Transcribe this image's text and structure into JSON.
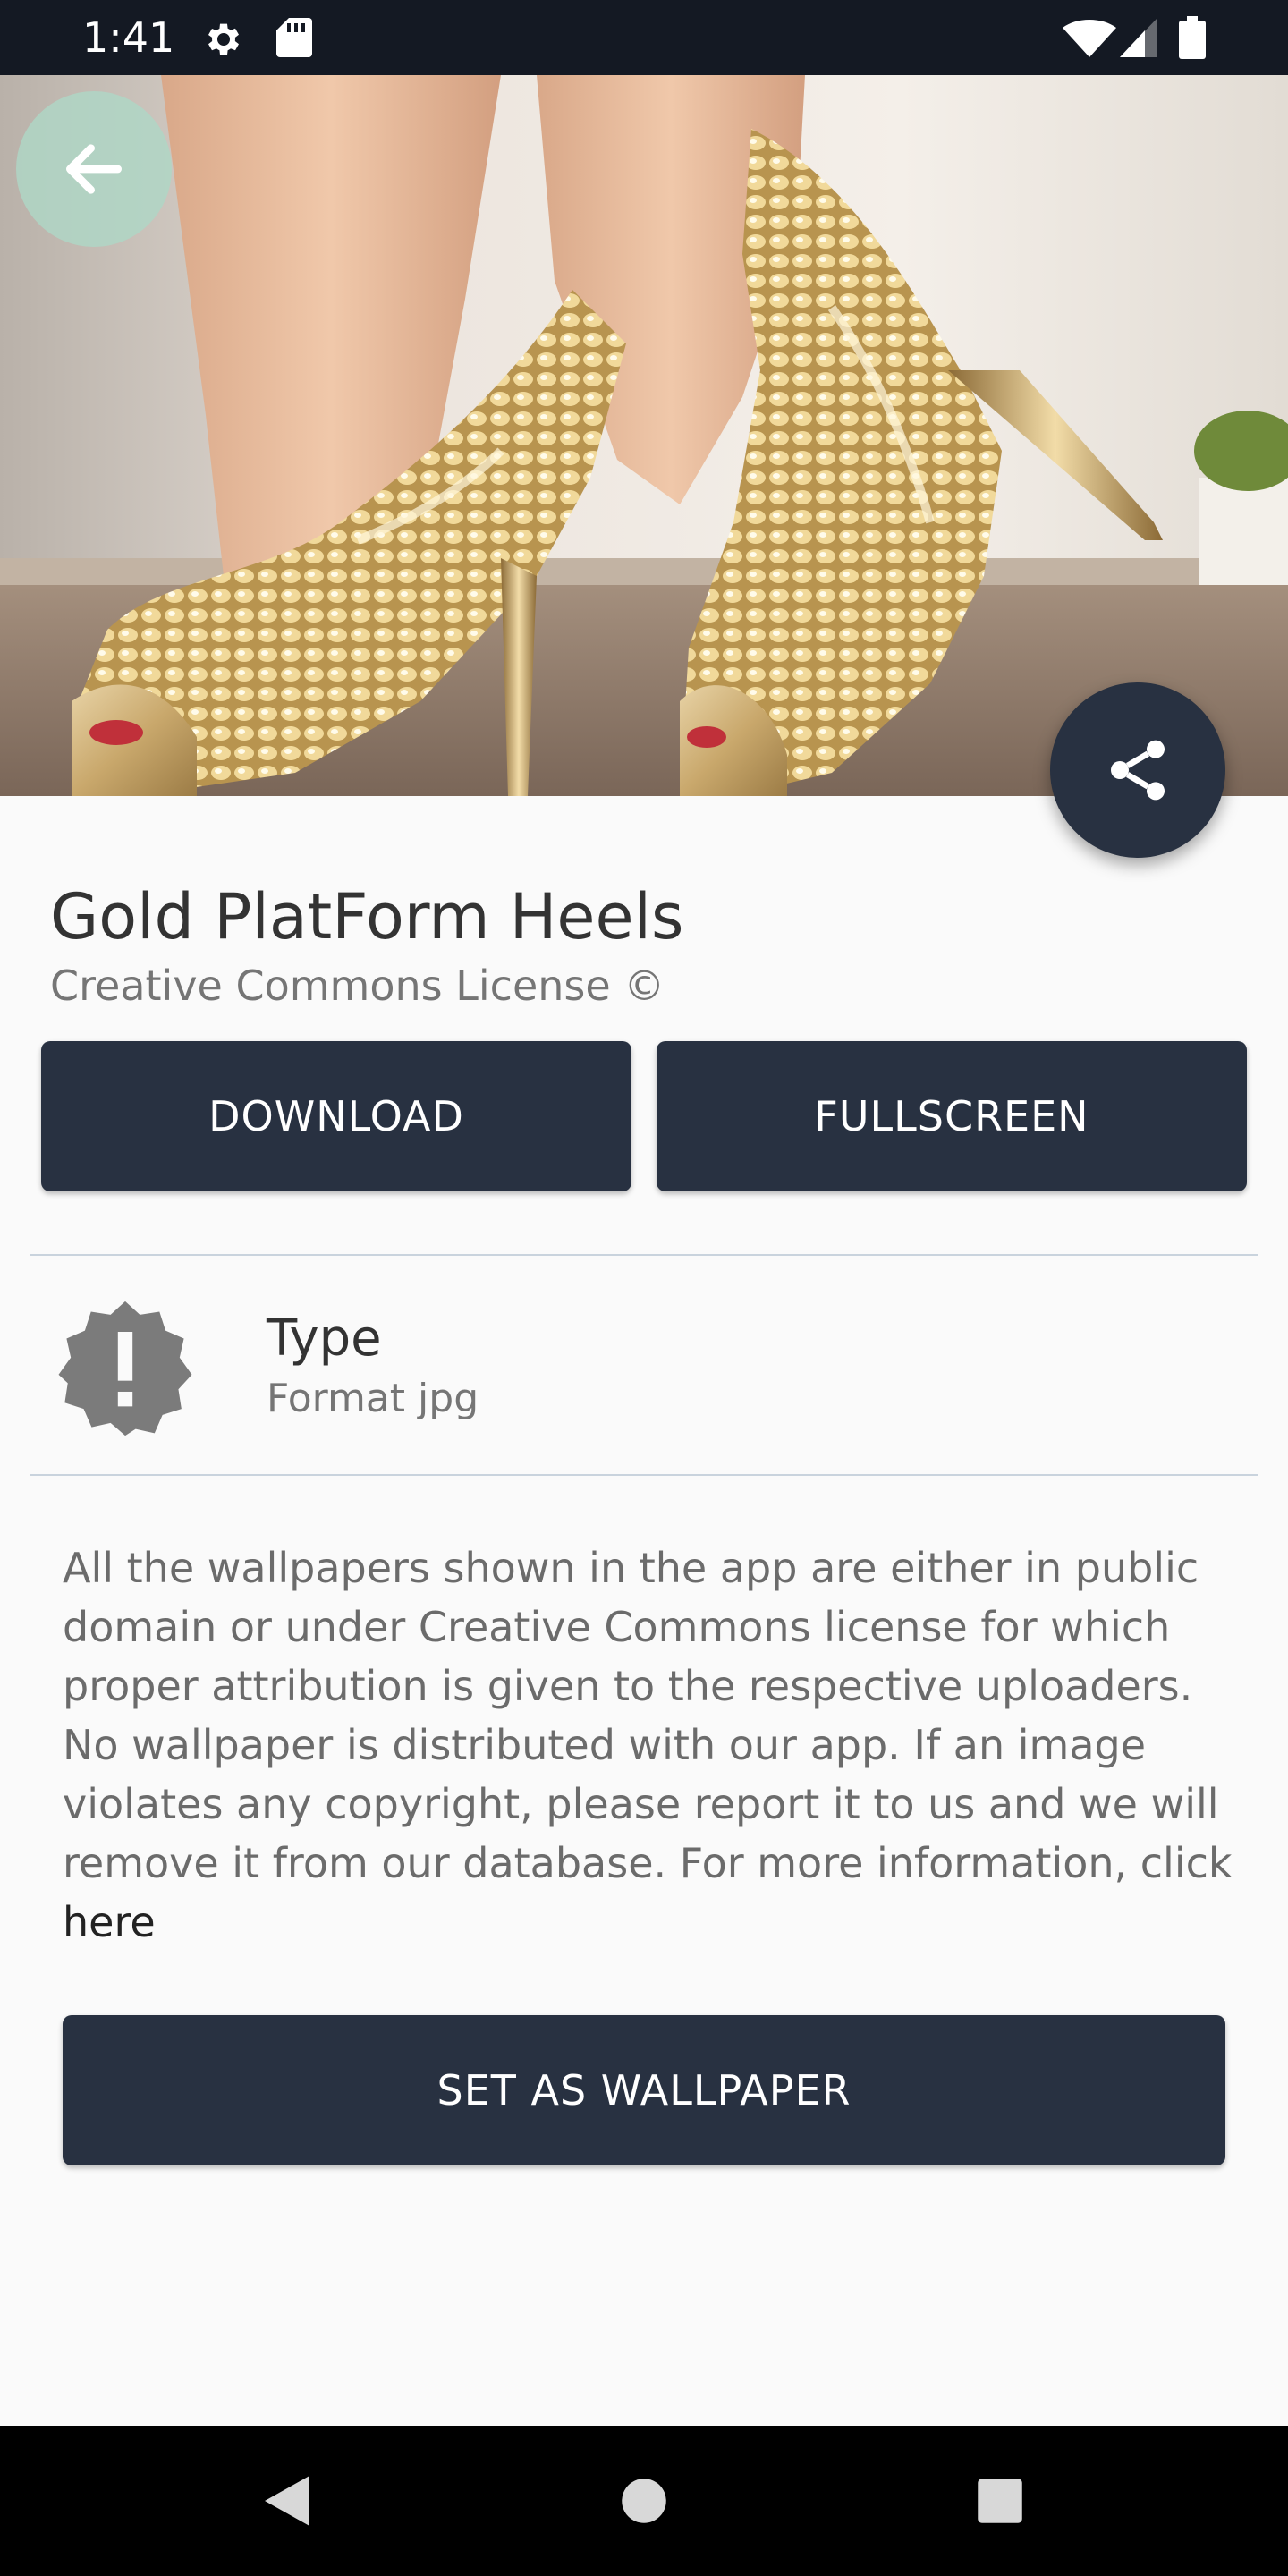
{
  "status_bar": {
    "time": "1:41",
    "icons": [
      "gear-icon",
      "sd-card-icon",
      "wifi-icon",
      "signal-icon",
      "battery-icon"
    ]
  },
  "hero": {
    "image": "gold-platform-heels-photo",
    "back_icon": "arrow-left-icon",
    "share_icon": "share-icon"
  },
  "wallpaper": {
    "title": "Gold PlatForm Heels",
    "license": "Creative Commons License ©"
  },
  "actions": {
    "download_label": "DOWNLOAD",
    "fullscreen_label": "FULLSCREEN",
    "set_wallpaper_label": "SET AS WALLPAPER"
  },
  "info": {
    "icon": "alert-badge-icon",
    "type_label": "Type",
    "type_value": "Format jpg"
  },
  "disclaimer": {
    "text": "All the wallpapers shown in the app are either in public domain or under Creative Commons license for which proper attribution is given to the respective uploaders. No wallpaper is distributed with our app. If an image violates any copyright, please report it to us and we will remove it from our database. For more information, click ",
    "link_text": "here"
  },
  "nav_bar": {
    "icons": [
      "nav-back-icon",
      "nav-home-icon",
      "nav-recents-icon"
    ]
  },
  "colors": {
    "primary_dark": "#283141",
    "status_bar": "#141923",
    "back_button": "#aed7c6",
    "background": "#fafafa"
  }
}
